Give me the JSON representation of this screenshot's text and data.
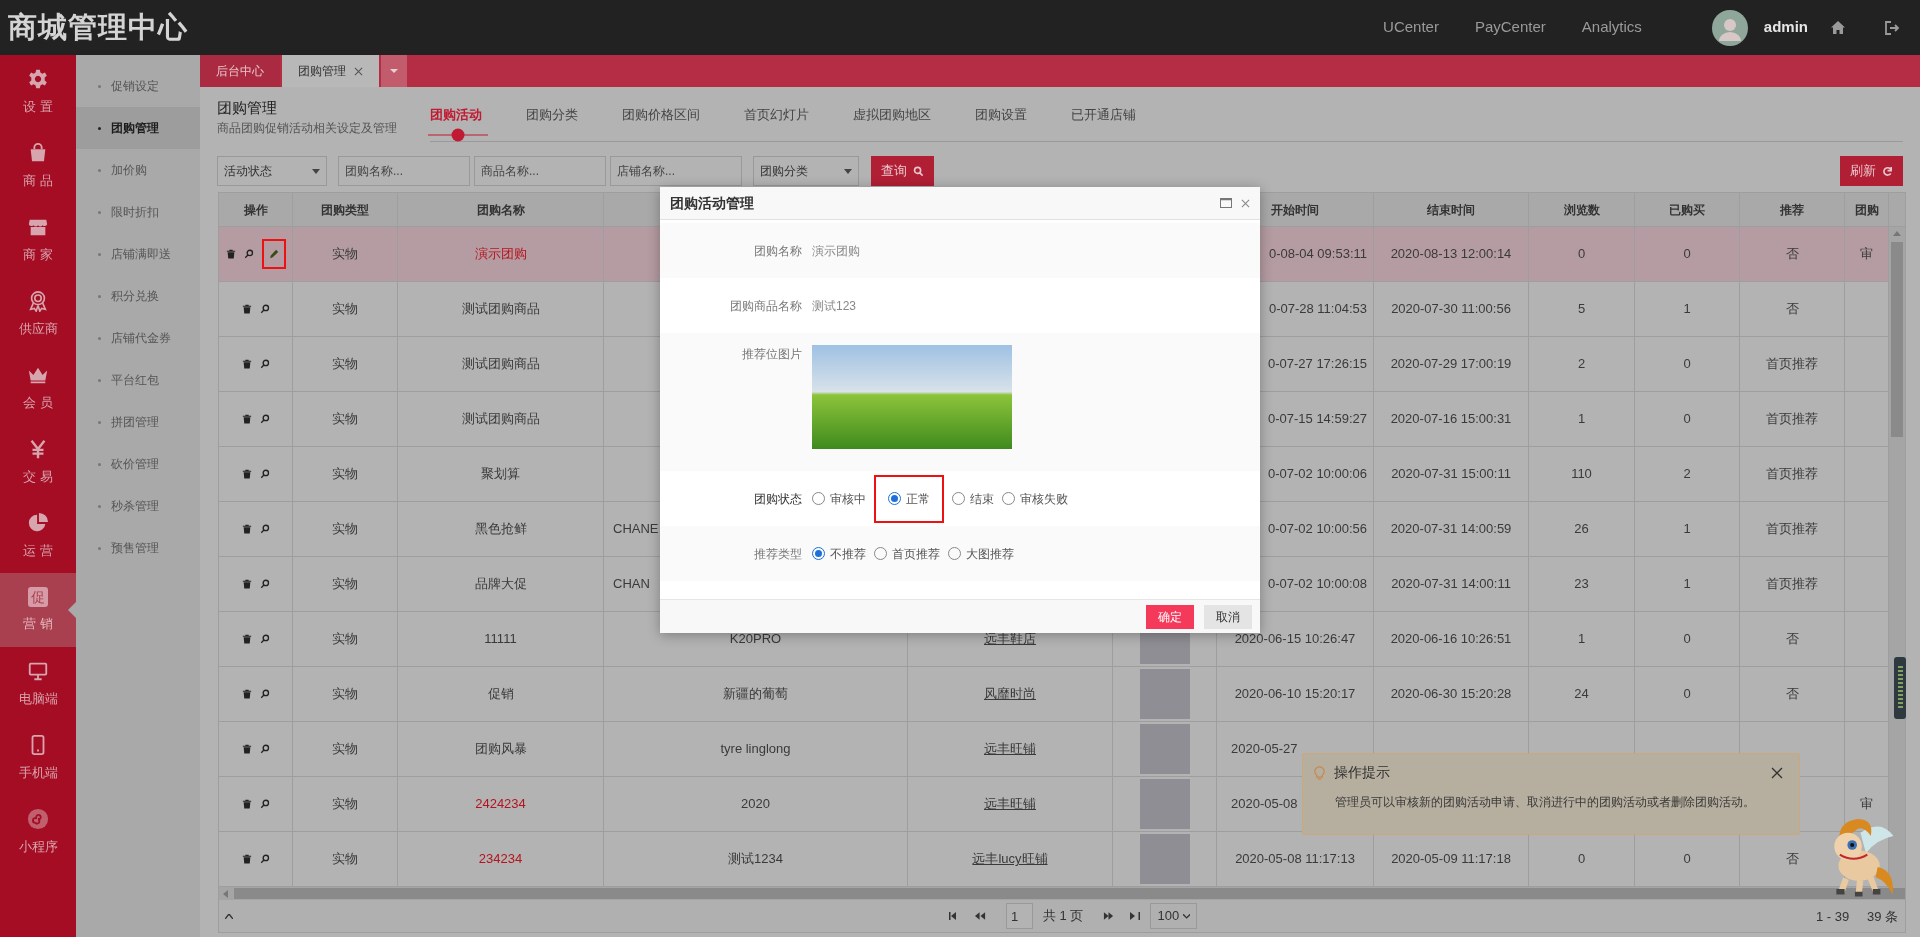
{
  "header": {
    "title": "商城管理中心",
    "links": [
      "UCenter",
      "PayCenter",
      "Analytics"
    ],
    "user": "admin"
  },
  "nav": [
    {
      "label": "设置",
      "kind": "gear",
      "selected": false
    },
    {
      "label": "商品",
      "kind": "bag",
      "selected": false
    },
    {
      "label": "商家",
      "kind": "store",
      "selected": false
    },
    {
      "label": "供应商",
      "kind": "award",
      "selected": false
    },
    {
      "label": "会员",
      "kind": "crown",
      "selected": false
    },
    {
      "label": "交易",
      "kind": "yen",
      "selected": false
    },
    {
      "label": "运营",
      "kind": "pie",
      "selected": false
    },
    {
      "label": "营销",
      "kind": "glyph",
      "glyph": "促",
      "selected": true
    },
    {
      "label": "电脑端",
      "kind": "monitor",
      "selected": false
    },
    {
      "label": "手机端",
      "kind": "phone",
      "selected": false
    },
    {
      "label": "小程序",
      "kind": "mini",
      "selected": false
    }
  ],
  "subnav": [
    {
      "label": "促销设定",
      "selected": false
    },
    {
      "label": "团购管理",
      "selected": true
    },
    {
      "label": "加价购",
      "selected": false
    },
    {
      "label": "限时折扣",
      "selected": false
    },
    {
      "label": "店铺满即送",
      "selected": false
    },
    {
      "label": "积分兑换",
      "selected": false
    },
    {
      "label": "店铺代金券",
      "selected": false
    },
    {
      "label": "平台红包",
      "selected": false
    },
    {
      "label": "拼团管理",
      "selected": false
    },
    {
      "label": "砍价管理",
      "selected": false
    },
    {
      "label": "秒杀管理",
      "selected": false
    },
    {
      "label": "预售管理",
      "selected": false
    }
  ],
  "tabs": [
    {
      "label": "后台中心",
      "selected": false,
      "closable": false
    },
    {
      "label": "团购管理",
      "selected": true,
      "closable": true
    }
  ],
  "page": {
    "title": "团购管理",
    "subtitle": "商品团购促销活动相关设定及管理",
    "tabs": [
      {
        "label": "团购活动",
        "selected": true
      },
      {
        "label": "团购分类",
        "selected": false
      },
      {
        "label": "团购价格区间",
        "selected": false
      },
      {
        "label": "首页幻灯片",
        "selected": false
      },
      {
        "label": "虚拟团购地区",
        "selected": false
      },
      {
        "label": "团购设置",
        "selected": false
      },
      {
        "label": "已开通店铺",
        "selected": false
      }
    ]
  },
  "filters": [
    {
      "kind": "select",
      "value": "活动状态"
    },
    {
      "kind": "input",
      "placeholder": "团购名称..."
    },
    {
      "kind": "input",
      "placeholder": "商品名称..."
    },
    {
      "kind": "input",
      "placeholder": "店铺名称..."
    },
    {
      "kind": "select",
      "value": "团购分类"
    }
  ],
  "query_button": "查询",
  "refresh_button": "刷新",
  "table": {
    "columns": [
      "操作",
      "团购类型",
      "团购名称",
      "",
      "",
      "",
      "开始时间",
      "结束时间",
      "浏览数",
      "已购买",
      "推荐",
      "团购"
    ],
    "rows": [
      {
        "selected": true,
        "actions": [
          {
            "kind": "delete"
          },
          {
            "kind": "view"
          },
          {
            "kind": "edit",
            "annotated": true
          }
        ],
        "type": "实物",
        "name": "演示团购",
        "highlighted": true,
        "start": "0-08-04 09:53:11",
        "end": "2020-08-13 12:00:14",
        "views": "0",
        "bought": "0",
        "recommend": "否",
        "status": "审"
      },
      {
        "selected": false,
        "actions": [
          {
            "kind": "delete"
          },
          {
            "kind": "view"
          }
        ],
        "type": "实物",
        "name": "测试团购商品",
        "highlighted": false,
        "start": "0-07-28 11:04:53",
        "end": "2020-07-30 11:00:56",
        "views": "5",
        "bought": "1",
        "recommend": "否"
      },
      {
        "selected": false,
        "actions": [
          {
            "kind": "delete"
          },
          {
            "kind": "view"
          }
        ],
        "type": "实物",
        "name": "测试团购商品",
        "highlighted": false,
        "start": "0-07-27 17:26:15",
        "end": "2020-07-29 17:00:19",
        "views": "2",
        "bought": "0",
        "recommend": "首页推荐"
      },
      {
        "selected": false,
        "actions": [
          {
            "kind": "delete"
          },
          {
            "kind": "view"
          }
        ],
        "type": "实物",
        "name": "测试团购商品",
        "highlighted": false,
        "start": "0-07-15 14:59:27",
        "end": "2020-07-16 15:00:31",
        "views": "1",
        "bought": "0",
        "recommend": "首页推荐"
      },
      {
        "selected": false,
        "actions": [
          {
            "kind": "delete"
          },
          {
            "kind": "view"
          }
        ],
        "type": "实物",
        "name": "聚划算",
        "highlighted": false,
        "start": "0-07-02 10:00:06",
        "end": "2020-07-31 15:00:11",
        "views": "110",
        "bought": "2",
        "recommend": "首页推荐"
      },
      {
        "selected": false,
        "actions": [
          {
            "kind": "delete"
          },
          {
            "kind": "view"
          }
        ],
        "type": "实物",
        "name": "黑色抢鲜",
        "highlighted": false,
        "product": "CHANE",
        "start": "0-07-02 10:00:56",
        "end": "2020-07-31 14:00:59",
        "views": "26",
        "bought": "1",
        "recommend": "首页推荐"
      },
      {
        "selected": false,
        "actions": [
          {
            "kind": "delete"
          },
          {
            "kind": "view"
          }
        ],
        "type": "实物",
        "name": "品牌大促",
        "highlighted": false,
        "product": "CHAN",
        "start": "0-07-02 10:00:08",
        "end": "2020-07-31 14:00:11",
        "views": "23",
        "bought": "1",
        "recommend": "首页推荐"
      },
      {
        "selected": false,
        "actions": [
          {
            "kind": "delete"
          },
          {
            "kind": "view"
          }
        ],
        "type": "实物",
        "name": "11111",
        "highlighted": false,
        "product": "K20PRO",
        "store": "远丰鞋店",
        "image": true,
        "start": "2020-06-15 10:26:47",
        "end": "2020-06-16 10:26:51",
        "views": "1",
        "bought": "0",
        "recommend": "否"
      },
      {
        "selected": false,
        "actions": [
          {
            "kind": "delete"
          },
          {
            "kind": "view"
          }
        ],
        "type": "实物",
        "name": "促销",
        "highlighted": false,
        "product": "新疆的葡萄",
        "store": "风靡时尚",
        "image": true,
        "start": "2020-06-10 15:20:17",
        "end": "2020-06-30 15:20:28",
        "views": "24",
        "bought": "0",
        "recommend": "否"
      },
      {
        "selected": false,
        "actions": [
          {
            "kind": "delete"
          },
          {
            "kind": "view"
          }
        ],
        "type": "实物",
        "name": "团购风暴",
        "highlighted": false,
        "product": "tyre linglong",
        "store": "远丰旺铺",
        "image": true,
        "start": "2020-05-27"
      },
      {
        "selected": false,
        "actions": [
          {
            "kind": "delete"
          },
          {
            "kind": "view"
          }
        ],
        "type": "实物",
        "name": "2424234",
        "highlighted": true,
        "product": "2020",
        "store": "远丰旺铺",
        "image": true,
        "start": "2020-05-08",
        "status": "审"
      },
      {
        "selected": false,
        "actions": [
          {
            "kind": "delete"
          },
          {
            "kind": "view"
          }
        ],
        "type": "实物",
        "name": "234234",
        "highlighted": true,
        "product": "测试1234",
        "store": "远丰lucy旺铺",
        "image": true,
        "start": "2020-05-08 11:17:13",
        "end": "2020-05-09 11:17:18",
        "views": "0",
        "bought": "0",
        "recommend": "否"
      }
    ]
  },
  "pagination": {
    "page": "1",
    "pages": "共 1 页",
    "page_size": "100",
    "range": "1 - 39",
    "total": "39 条"
  },
  "dialog": {
    "title": "团购活动管理",
    "fields": [
      {
        "kind": "text",
        "label": "团购名称",
        "value": "演示团购"
      },
      {
        "kind": "text",
        "label": "团购商品名称",
        "value": "测试123"
      },
      {
        "kind": "image",
        "label": "推荐位图片"
      },
      {
        "kind": "radio",
        "label": "团购状态",
        "options": [
          {
            "label": "审核中",
            "selected": false
          },
          {
            "label": "正常",
            "selected": true,
            "annotated": true
          },
          {
            "label": "结束",
            "selected": false
          },
          {
            "label": "审核失败",
            "selected": false
          }
        ]
      },
      {
        "kind": "radio",
        "label": "推荐类型",
        "options": [
          {
            "label": "不推荐",
            "selected": true
          },
          {
            "label": "首页推荐",
            "selected": false
          },
          {
            "label": "大图推荐",
            "selected": false
          }
        ]
      }
    ],
    "buttons": [
      {
        "label": "确定",
        "kind": "primary"
      },
      {
        "label": "取消",
        "kind": "secondary"
      }
    ]
  },
  "tip": {
    "title": "操作提示",
    "text": "管理员可以审核新的团购活动申请、取消进行中的团购活动或者删除团购活动。"
  }
}
